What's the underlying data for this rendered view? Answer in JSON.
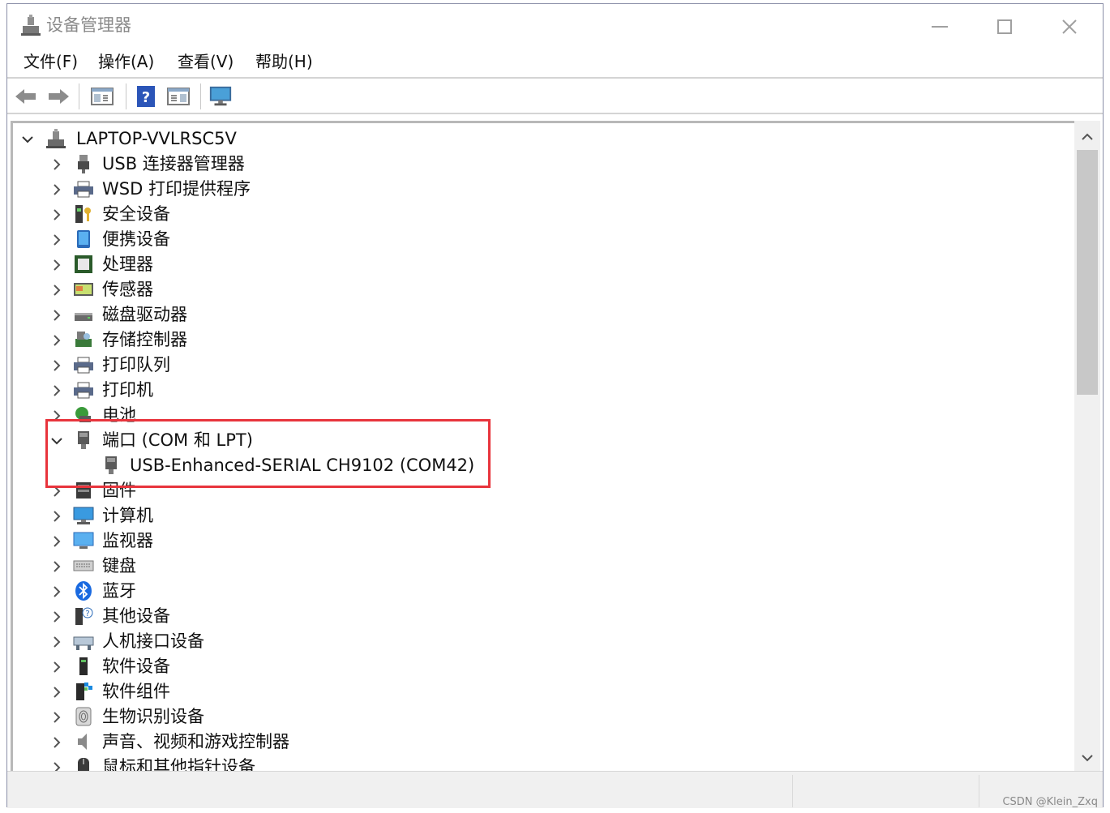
{
  "window": {
    "title": "设备管理器",
    "controls": {
      "minimize": "minimize-icon",
      "maximize": "maximize-icon",
      "close": "close-icon"
    }
  },
  "menu": [
    "文件(F)",
    "操作(A)",
    "查看(V)",
    "帮助(H)"
  ],
  "toolbar": {
    "buttons": [
      "back-arrow-icon",
      "forward-arrow-icon",
      "show-hide-console-tree-icon",
      "help-icon",
      "properties-pane-icon",
      "scan-hardware-monitor-icon"
    ]
  },
  "tree": {
    "root": {
      "label": "LAPTOP-VVLRSC5V",
      "expanded": true,
      "icon": "computer-root-icon"
    },
    "items": [
      {
        "label": "USB 连接器管理器",
        "icon": "usb-connector-icon",
        "expanded": false
      },
      {
        "label": "WSD 打印提供程序",
        "icon": "printer-icon",
        "expanded": false
      },
      {
        "label": "安全设备",
        "icon": "security-device-icon",
        "expanded": false
      },
      {
        "label": "便携设备",
        "icon": "portable-device-icon",
        "expanded": false
      },
      {
        "label": "处理器",
        "icon": "processor-icon",
        "expanded": false
      },
      {
        "label": "传感器",
        "icon": "sensor-icon",
        "expanded": false
      },
      {
        "label": "磁盘驱动器",
        "icon": "disk-drive-icon",
        "expanded": false
      },
      {
        "label": "存储控制器",
        "icon": "storage-controller-icon",
        "expanded": false
      },
      {
        "label": "打印队列",
        "icon": "print-queue-icon",
        "expanded": false
      },
      {
        "label": "打印机",
        "icon": "printer-icon",
        "expanded": false
      },
      {
        "label": "电池",
        "icon": "battery-icon",
        "expanded": false
      },
      {
        "label": "端口 (COM 和 LPT)",
        "icon": "port-icon",
        "expanded": true,
        "children": [
          {
            "label": "USB-Enhanced-SERIAL CH9102 (COM42)",
            "icon": "port-icon"
          }
        ]
      },
      {
        "label": "固件",
        "icon": "firmware-icon",
        "expanded": false
      },
      {
        "label": "计算机",
        "icon": "computer-icon",
        "expanded": false
      },
      {
        "label": "监视器",
        "icon": "monitor-icon",
        "expanded": false
      },
      {
        "label": "键盘",
        "icon": "keyboard-icon",
        "expanded": false
      },
      {
        "label": "蓝牙",
        "icon": "bluetooth-icon",
        "expanded": false
      },
      {
        "label": "其他设备",
        "icon": "other-device-icon",
        "expanded": false
      },
      {
        "label": "人机接口设备",
        "icon": "hid-icon",
        "expanded": false
      },
      {
        "label": "软件设备",
        "icon": "software-device-icon",
        "expanded": false
      },
      {
        "label": "软件组件",
        "icon": "software-component-icon",
        "expanded": false
      },
      {
        "label": "生物识别设备",
        "icon": "biometric-icon",
        "expanded": false
      },
      {
        "label": "声音、视频和游戏控制器",
        "icon": "sound-icon",
        "expanded": false
      },
      {
        "label": "鼠标和其他指针设备",
        "icon": "mouse-icon",
        "expanded": false
      }
    ]
  },
  "highlight": {
    "color": "#e8343c",
    "target": "端口 (COM 和 LPT)"
  },
  "watermark": "CSDN @Klein_Zxq"
}
